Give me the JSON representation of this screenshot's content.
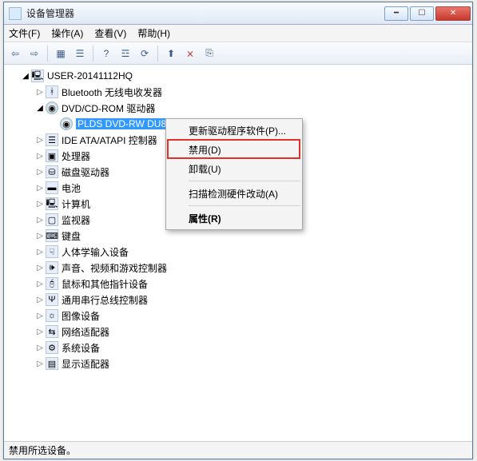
{
  "window": {
    "title": "设备管理器"
  },
  "menu": {
    "file": "文件(F)",
    "action": "操作(A)",
    "view": "查看(V)",
    "help": "帮助(H)"
  },
  "toolbar_icons": [
    "back",
    "forward",
    "|",
    "grid",
    "tree",
    "|",
    "help",
    "list",
    "refresh",
    "|",
    "update",
    "disable",
    "uninstall"
  ],
  "tree": {
    "root": "USER-20141112HQ",
    "nodes": [
      {
        "label": "Bluetooth 无线电收发器",
        "icon": "bluetooth-icon",
        "glyph": "ᚼ",
        "arrow": "closed"
      },
      {
        "label": "DVD/CD-ROM 驱动器",
        "icon": "optical-drive-icon",
        "glyph": "◉",
        "arrow": "open",
        "children": [
          {
            "label": "PLDS DVD-RW DU8A5SH",
            "icon": "optical-drive-icon",
            "glyph": "◉",
            "selected": true
          }
        ]
      },
      {
        "label": "IDE ATA/ATAPI 控制器",
        "icon": "ide-controller-icon",
        "glyph": "☰",
        "arrow": "closed"
      },
      {
        "label": "处理器",
        "icon": "processor-icon",
        "glyph": "▣",
        "arrow": "closed"
      },
      {
        "label": "磁盘驱动器",
        "icon": "disk-drive-icon",
        "glyph": "⛁",
        "arrow": "closed"
      },
      {
        "label": "电池",
        "icon": "battery-icon",
        "glyph": "▬",
        "arrow": "closed"
      },
      {
        "label": "计算机",
        "icon": "computer-icon",
        "glyph": "🖳",
        "arrow": "closed"
      },
      {
        "label": "监视器",
        "icon": "monitor-icon",
        "glyph": "▢",
        "arrow": "closed"
      },
      {
        "label": "键盘",
        "icon": "keyboard-icon",
        "glyph": "⌨",
        "arrow": "closed"
      },
      {
        "label": "人体学输入设备",
        "icon": "hid-icon",
        "glyph": "☟",
        "arrow": "closed"
      },
      {
        "label": "声音、视频和游戏控制器",
        "icon": "sound-icon",
        "glyph": "🕪",
        "arrow": "closed"
      },
      {
        "label": "鼠标和其他指针设备",
        "icon": "mouse-icon",
        "glyph": "🖯",
        "arrow": "closed"
      },
      {
        "label": "通用串行总线控制器",
        "icon": "usb-icon",
        "glyph": "Ψ",
        "arrow": "closed"
      },
      {
        "label": "图像设备",
        "icon": "imaging-icon",
        "glyph": "☼",
        "arrow": "closed"
      },
      {
        "label": "网络适配器",
        "icon": "network-adapter-icon",
        "glyph": "⇆",
        "arrow": "closed"
      },
      {
        "label": "系统设备",
        "icon": "system-device-icon",
        "glyph": "⚙",
        "arrow": "closed"
      },
      {
        "label": "显示适配器",
        "icon": "display-adapter-icon",
        "glyph": "▤",
        "arrow": "closed"
      }
    ]
  },
  "context_menu": {
    "items": [
      {
        "label": "更新驱动程序软件(P)...",
        "id": "update-driver"
      },
      {
        "label": "禁用(D)",
        "id": "disable",
        "highlighted": true
      },
      {
        "label": "卸载(U)",
        "id": "uninstall"
      },
      {
        "sep": true
      },
      {
        "label": "扫描检测硬件改动(A)",
        "id": "scan-hardware"
      },
      {
        "sep": true
      },
      {
        "label": "属性(R)",
        "id": "properties",
        "bold": true
      }
    ]
  },
  "status": "禁用所选设备。"
}
